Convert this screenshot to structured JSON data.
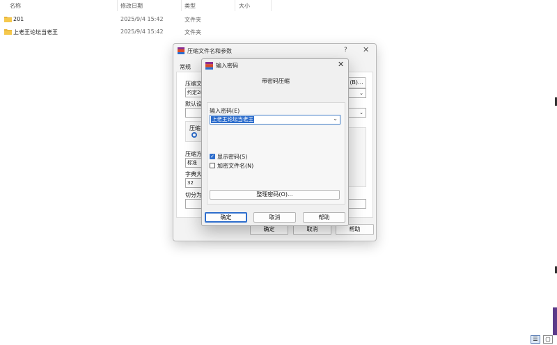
{
  "explorer": {
    "columns": {
      "name": "名称",
      "modified": "修改日期",
      "type": "类型",
      "size": "大小"
    },
    "rows": [
      {
        "name": "201",
        "modified": "2025/9/4 15:42",
        "type": "文件夹"
      },
      {
        "name": "上老王论坛当老王",
        "modified": "2025/9/4 15:42",
        "type": "文件夹"
      }
    ],
    "colors": {
      "folder": "#e8b53a",
      "accent": "#2d6dcc"
    }
  },
  "back_dialog": {
    "title": "压缩文件名和参数",
    "help_glyph": "?",
    "close_glyph": "✕",
    "tab_general": "常规",
    "archive_name_label": "压缩文",
    "archive_name_value": "约定2(",
    "browse_button": "(B)...",
    "default_label": "默认设",
    "format_label": "压缩",
    "method_label": "压缩方",
    "method_value": "标准",
    "dict_label": "字典大",
    "dict_value": "32",
    "split_label": "切分为",
    "ok": "确定",
    "cancel": "取消",
    "help": "帮助"
  },
  "front_dialog": {
    "title": "输入密码",
    "close_glyph": "✕",
    "subtitle": "带密码压缩",
    "password_label": "输入密码(E)",
    "password_value": "上老王论坛当老王",
    "show_password": "显示密码(S)",
    "show_password_checked": true,
    "encrypt_names": "加密文件名(N)",
    "encrypt_names_checked": false,
    "organize_button": "整理密码(O)...",
    "ok": "确定",
    "cancel": "取消",
    "help": "帮助"
  },
  "taskbar_views": {
    "details": "☰",
    "tiles": "▢"
  }
}
